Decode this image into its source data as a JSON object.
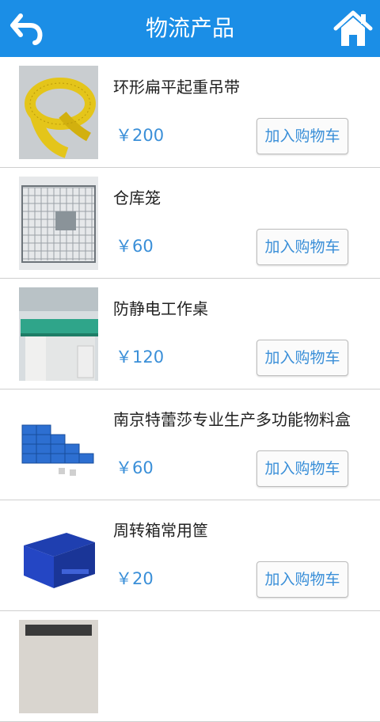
{
  "header": {
    "title": "物流产品"
  },
  "products": [
    {
      "name": "环形扁平起重吊带",
      "price": "￥200",
      "cart_label": "加入购物车"
    },
    {
      "name": "仓库笼",
      "price": "￥60",
      "cart_label": "加入购物车"
    },
    {
      "name": "防静电工作桌",
      "price": "￥120",
      "cart_label": "加入购物车"
    },
    {
      "name": "南京特蕾莎专业生产多功能物料盒",
      "price": "￥60",
      "cart_label": "加入购物车"
    },
    {
      "name": "周转箱常用筐",
      "price": "￥20",
      "cart_label": "加入购物车"
    }
  ],
  "icons": {
    "back": "back-arrow-icon",
    "home": "home-icon"
  },
  "colors": {
    "header": "#1b8ee6",
    "accent": "#3a8fd8"
  }
}
